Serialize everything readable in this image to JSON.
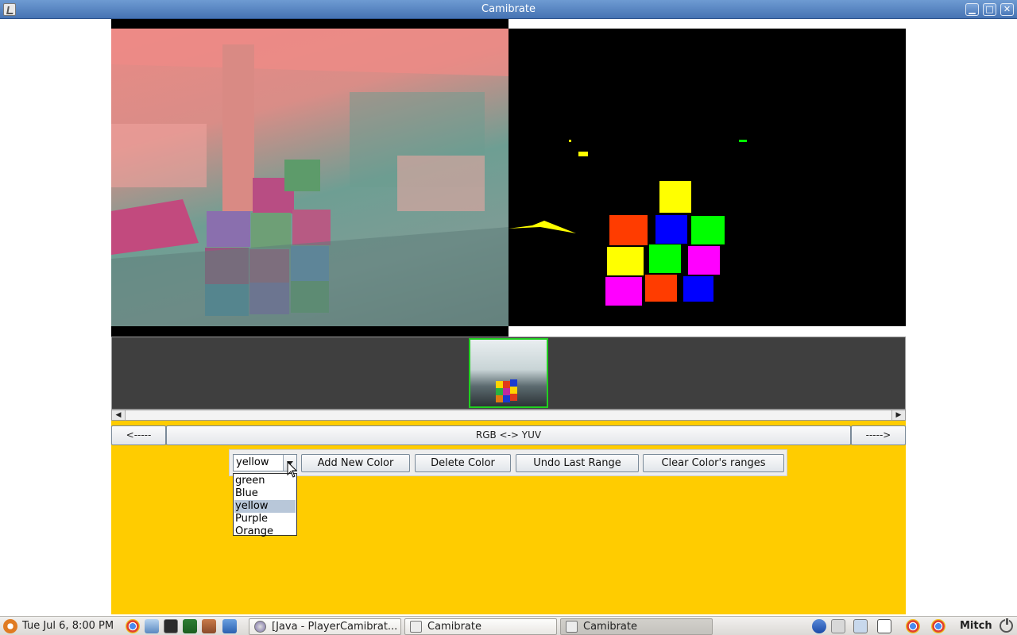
{
  "window": {
    "title": "Camibrate"
  },
  "nav": {
    "prev_label": "<-----",
    "mode_label": "RGB <-> YUV",
    "next_label": "----->"
  },
  "controls": {
    "selected_color": "yellow",
    "add_label": "Add New Color",
    "delete_label": "Delete Color",
    "undo_label": "Undo Last Range",
    "clear_label": "Clear Color's ranges"
  },
  "dropdown": {
    "options": [
      "green",
      "Blue",
      "yellow",
      "Purple",
      "Orange"
    ],
    "selected_index": 2
  },
  "colors": {
    "app_bg": "#ffcc00",
    "titlebar": "#4f7fc0",
    "thumb_border": "#20d020",
    "selection": "#b8c7d9"
  },
  "taskbar": {
    "clock": "Tue Jul  6,  8:00 PM",
    "tasks": [
      {
        "label": "[Java - PlayerCamibrat...",
        "active": false
      },
      {
        "label": "Camibrate",
        "active": false
      },
      {
        "label": "Camibrate",
        "active": true
      }
    ],
    "user": "Mitch",
    "launcher_icons": [
      "chrome-icon",
      "computer-icon",
      "terminal-icon",
      "monitor-icon",
      "package-icon",
      "files-icon"
    ],
    "tray_icons": [
      "bluetooth-icon",
      "network-icon",
      "app-icon",
      "window-icon",
      "chrome-icon",
      "chrome-icon"
    ]
  }
}
